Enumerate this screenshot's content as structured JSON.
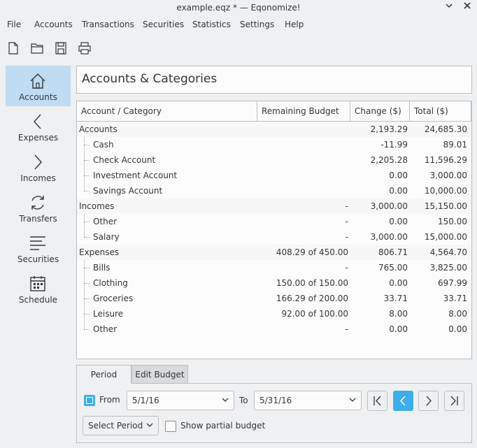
{
  "window": {
    "title": "example.eqz * — Eqonomize!"
  },
  "menu": [
    "File",
    "Accounts",
    "Transactions",
    "Securities",
    "Statistics",
    "Settings",
    "Help"
  ],
  "toolbar": [
    "new-icon",
    "open-icon",
    "save-icon",
    "print-icon"
  ],
  "sidebar": [
    {
      "label": "Accounts",
      "icon": "home-icon",
      "active": true
    },
    {
      "label": "Expenses",
      "icon": "chevron-left-icon"
    },
    {
      "label": "Incomes",
      "icon": "chevron-right-icon"
    },
    {
      "label": "Transfers",
      "icon": "refresh-icon"
    },
    {
      "label": "Securities",
      "icon": "lines-icon"
    },
    {
      "label": "Schedule",
      "icon": "calendar-icon"
    }
  ],
  "header": {
    "title": "Accounts & Categories"
  },
  "table": {
    "columns": [
      "Account / Category",
      "Remaining Budget ($)",
      "Change ($)",
      "Total ($)"
    ],
    "rows": [
      {
        "name": "Accounts",
        "budget": "",
        "change": "2,193.29",
        "total": "24,685.30",
        "group": true
      },
      {
        "name": "Cash",
        "budget": "",
        "change": "-11.99",
        "total": "89.01"
      },
      {
        "name": "Check Account",
        "budget": "",
        "change": "2,205.28",
        "total": "11,596.29"
      },
      {
        "name": "Investment Account",
        "budget": "",
        "change": "0.00",
        "total": "3,000.00"
      },
      {
        "name": "Savings Account",
        "budget": "",
        "change": "0.00",
        "total": "10,000.00"
      },
      {
        "name": "Incomes",
        "budget": "-",
        "change": "3,000.00",
        "total": "15,150.00",
        "group": true
      },
      {
        "name": "Other",
        "budget": "-",
        "change": "0.00",
        "total": "150.00"
      },
      {
        "name": "Salary",
        "budget": "-",
        "change": "3,000.00",
        "total": "15,000.00"
      },
      {
        "name": "Expenses",
        "budget": "408.29 of 450.00",
        "change": "806.71",
        "total": "4,564.70",
        "group": true
      },
      {
        "name": "Bills",
        "budget": "-",
        "change": "765.00",
        "total": "3,825.00"
      },
      {
        "name": "Clothing",
        "budget": "150.00 of 150.00",
        "change": "0.00",
        "total": "697.99"
      },
      {
        "name": "Groceries",
        "budget": "166.29 of 200.00",
        "change": "33.71",
        "total": "33.71"
      },
      {
        "name": "Leisure",
        "budget": "92.00 of 100.00",
        "change": "8.00",
        "total": "8.00"
      },
      {
        "name": "Other",
        "budget": "-",
        "change": "0.00",
        "total": "0.00"
      }
    ]
  },
  "tabs": [
    "Period",
    "Edit Budget"
  ],
  "period": {
    "from_label": "From",
    "from_value": "5/1/16",
    "from_checked": true,
    "to_label": "To",
    "to_value": "5/31/16",
    "select_period_label": "Select Period",
    "partial_budget_label": "Show partial budget"
  },
  "colors": {
    "accent": "#3daee9",
    "selection": "#bfdcf3"
  }
}
